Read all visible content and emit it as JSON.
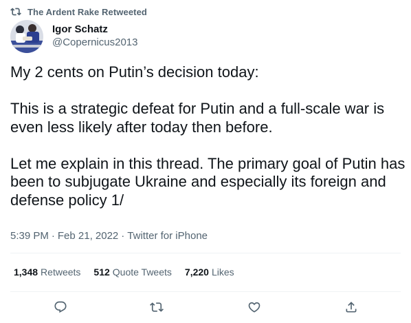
{
  "retweet_banner": {
    "text": "The Ardent Rake Retweeted",
    "icon": "retweet-icon"
  },
  "author": {
    "display_name": "Igor Schatz",
    "handle": "@Copernicus2013",
    "avatar_icon": "avatar-photo"
  },
  "tweet": {
    "paragraphs": [
      "My 2 cents on Putin’s decision today:",
      "This is a strategic defeat for Putin and a full-scale war is even less likely after today then before.",
      "Let me explain in this thread.  The primary goal of Putin has been to subjugate Ukraine and especially its foreign and defense policy 1/"
    ]
  },
  "meta": {
    "time": "5:39 PM",
    "separator": "·",
    "date": "Feb 21, 2022",
    "source": "Twitter for iPhone"
  },
  "stats": {
    "retweets_count": "1,348",
    "retweets_label": "Retweets",
    "quotes_count": "512",
    "quotes_label": "Quote Tweets",
    "likes_count": "7,220",
    "likes_label": "Likes"
  },
  "actions": {
    "reply_icon": "reply-icon",
    "retweet_icon": "retweet-icon",
    "like_icon": "heart-icon",
    "share_icon": "share-icon"
  },
  "colors": {
    "text": "#0f1419",
    "secondary": "#536471",
    "divider": "#eff3f4"
  }
}
